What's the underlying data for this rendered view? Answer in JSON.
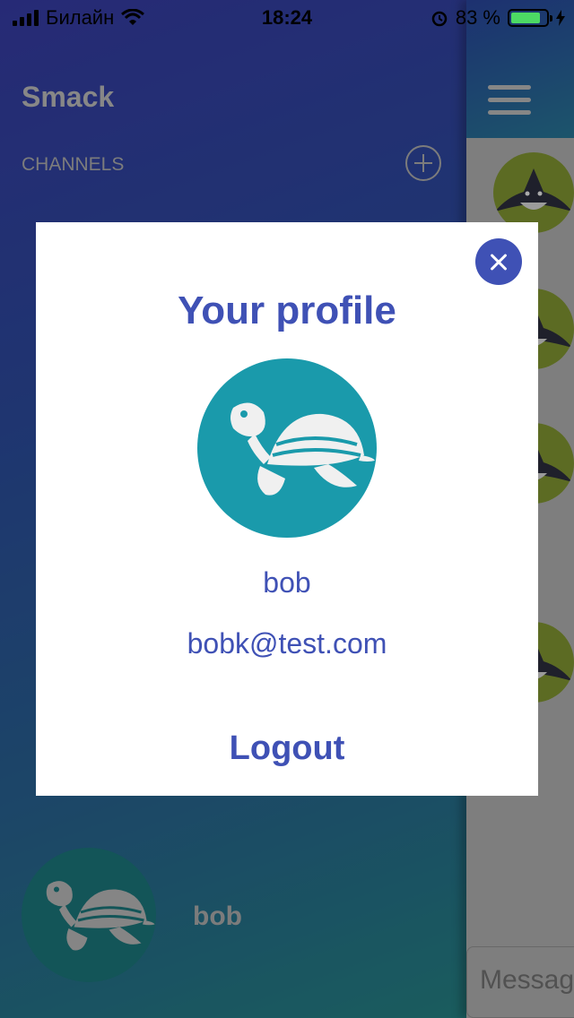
{
  "status_bar": {
    "carrier": "Билайн",
    "time": "18:24",
    "battery_percent": "83 %",
    "battery_level": 0.83
  },
  "sidebar": {
    "brand": "Smack",
    "channels_label": "CHANNELS",
    "user_name": "bob",
    "avatar_icon": "turtle-icon"
  },
  "chat": {
    "message_placeholder": "Message",
    "avatar_icon": "shark-icon"
  },
  "profile_modal": {
    "title": "Your profile",
    "name": "bob",
    "email": "bobk@test.com",
    "logout_label": "Logout",
    "avatar_icon": "turtle-icon"
  },
  "colors": {
    "accent": "#3f51b5",
    "avatar_bg": "#1a9aab",
    "shark_bg": "#8aa035"
  }
}
